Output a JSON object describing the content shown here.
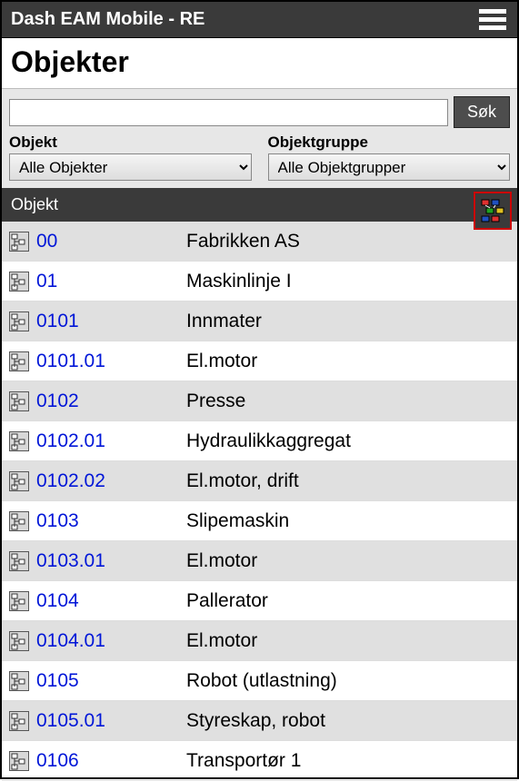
{
  "titlebar": {
    "title": "Dash EAM Mobile - RE"
  },
  "page": {
    "heading": "Objekter"
  },
  "search": {
    "value": "",
    "placeholder": "",
    "button": "Søk"
  },
  "filters": {
    "object_label": "Objekt",
    "object_selected": "Alle Objekter",
    "group_label": "Objektgruppe",
    "group_selected": "Alle Objektgrupper"
  },
  "table": {
    "header": "Objekt",
    "rows": [
      {
        "code": "00",
        "name": "Fabrikken AS"
      },
      {
        "code": "01",
        "name": "Maskinlinje I"
      },
      {
        "code": "0101",
        "name": "Innmater"
      },
      {
        "code": "0101.01",
        "name": "El.motor"
      },
      {
        "code": "0102",
        "name": "Presse"
      },
      {
        "code": "0102.01",
        "name": "Hydraulikkaggregat"
      },
      {
        "code": "0102.02",
        "name": "El.motor, drift"
      },
      {
        "code": "0103",
        "name": "Slipemaskin"
      },
      {
        "code": "0103.01",
        "name": "El.motor"
      },
      {
        "code": "0104",
        "name": "Pallerator"
      },
      {
        "code": "0104.01",
        "name": "El.motor"
      },
      {
        "code": "0105",
        "name": "Robot (utlastning)"
      },
      {
        "code": "0105.01",
        "name": "Styreskap, robot"
      },
      {
        "code": "0106",
        "name": "Transportør 1"
      }
    ]
  }
}
